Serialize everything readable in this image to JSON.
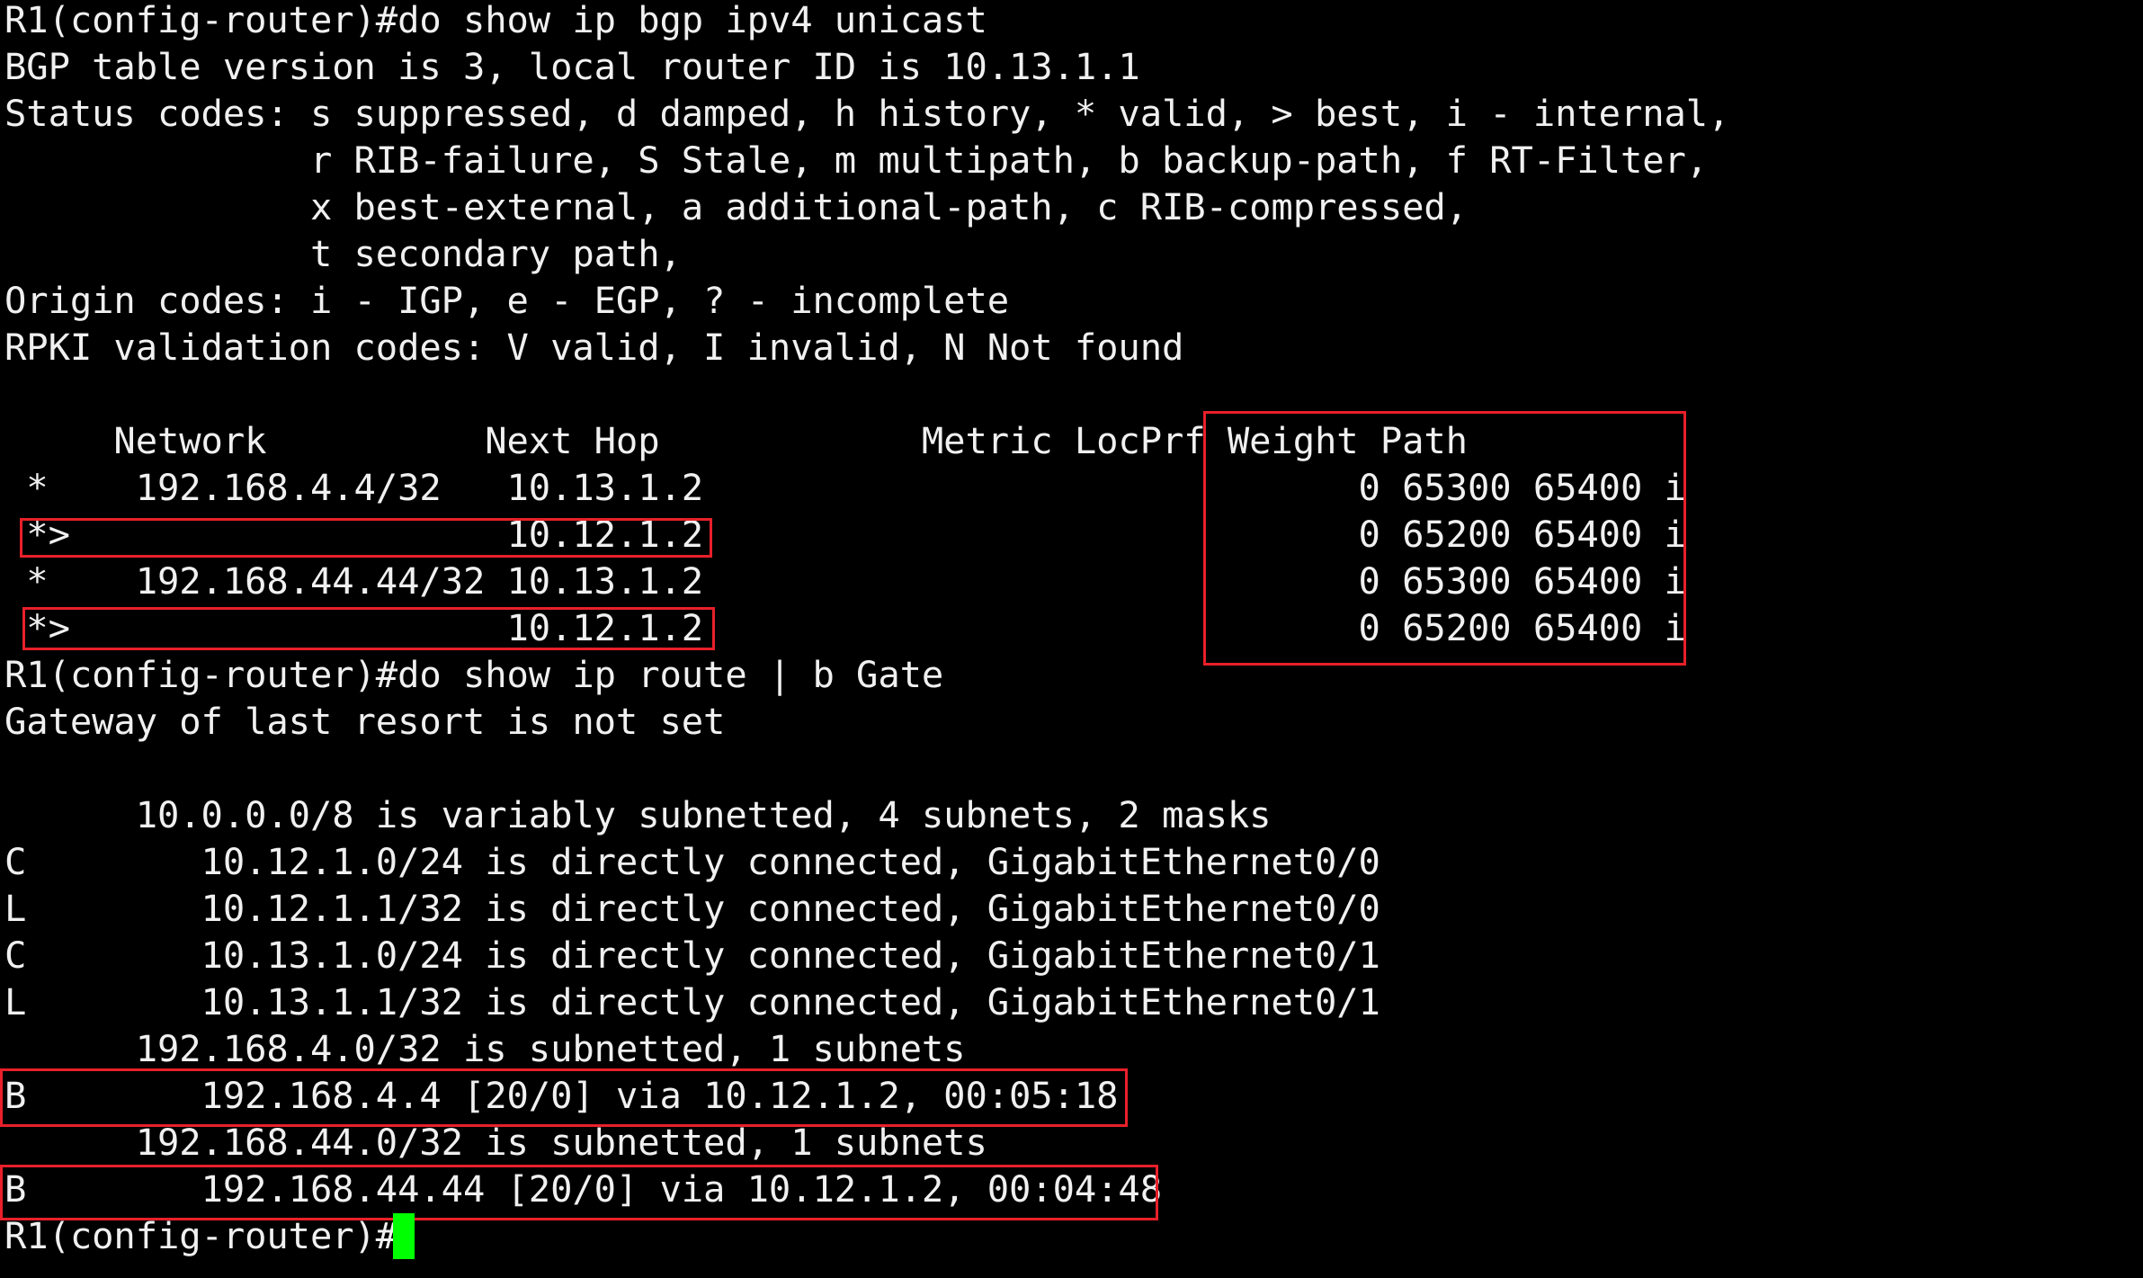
{
  "terminal": {
    "lines": [
      "R1(config-router)#do show ip bgp ipv4 unicast",
      "BGP table version is 3, local router ID is 10.13.1.1",
      "Status codes: s suppressed, d damped, h history, * valid, > best, i - internal,",
      "              r RIB-failure, S Stale, m multipath, b backup-path, f RT-Filter,",
      "              x best-external, a additional-path, c RIB-compressed,",
      "              t secondary path,",
      "Origin codes: i - IGP, e - EGP, ? - incomplete",
      "RPKI validation codes: V valid, I invalid, N Not found",
      "",
      "     Network          Next Hop            Metric LocPrf Weight Path",
      " *    192.168.4.4/32   10.13.1.2                              0 65300 65400 i",
      " *>                    10.12.1.2                              0 65200 65400 i",
      " *    192.168.44.44/32 10.13.1.2                              0 65300 65400 i",
      " *>                    10.12.1.2                              0 65200 65400 i",
      "R1(config-router)#do show ip route | b Gate",
      "Gateway of last resort is not set",
      "",
      "      10.0.0.0/8 is variably subnetted, 4 subnets, 2 masks",
      "C        10.12.1.0/24 is directly connected, GigabitEthernet0/0",
      "L        10.12.1.1/32 is directly connected, GigabitEthernet0/0",
      "C        10.13.1.0/24 is directly connected, GigabitEthernet0/1",
      "L        10.13.1.1/32 is directly connected, GigabitEthernet0/1",
      "      192.168.4.0/32 is subnetted, 1 subnets",
      "B        192.168.4.4 [20/0] via 10.12.1.2, 00:05:18",
      "      192.168.44.0/32 is subnetted, 1 subnets",
      "B        192.168.44.44 [20/0] via 10.12.1.2, 00:04:48",
      "R1(config-router)#"
    ]
  },
  "colors": {
    "background": "#000000",
    "text": "#f0f0f0",
    "highlight_box": "#e8202a",
    "cursor": "#00ff00"
  }
}
